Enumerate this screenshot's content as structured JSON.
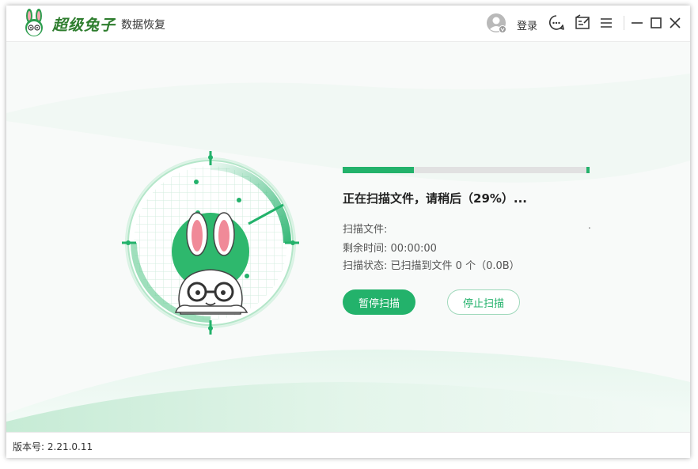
{
  "app": {
    "brand_name": "超级兔子",
    "product_name": "数据恢复",
    "logo_icon": "rabbit-logo-icon"
  },
  "titlebar": {
    "login_label": "登录",
    "icons": [
      "avatar-icon",
      "support-chat-icon",
      "feedback-icon",
      "menu-icon",
      "minimize-icon",
      "maximize-icon",
      "close-icon"
    ]
  },
  "scan": {
    "progress_percent": 29,
    "status_text": "正在扫描文件，请稍后（29%）...",
    "file_label": "扫描文件:",
    "file_value": "",
    "trailing_dot": ".",
    "remaining_label": "剩余时间:",
    "remaining_value": "00:00:00",
    "state_label": "扫描状态:",
    "state_value": "已扫描到文件 0 个（0.0B）",
    "pause_button": "暂停扫描",
    "stop_button": "停止扫描"
  },
  "footer": {
    "version_label": "版本号:",
    "version_value": "2.21.0.11"
  },
  "colors": {
    "accent": "#23b26b",
    "accent_light": "#9fd8bb",
    "brand_text": "#2e7d2e",
    "track": "#e1e1e1"
  }
}
